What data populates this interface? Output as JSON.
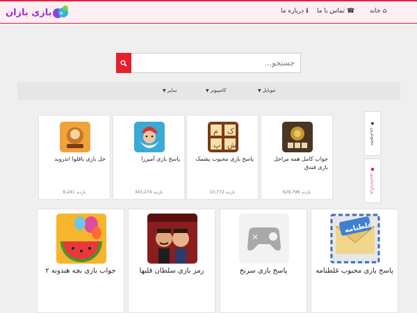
{
  "brand": {
    "name": "بازی بازان"
  },
  "nav": {
    "home": "خانه",
    "contact": "تماس با ما",
    "about": "درباره ما"
  },
  "search": {
    "placeholder": "جستجو..."
  },
  "categories": {
    "mobile": "موبایل",
    "computer": "کامپیوتر",
    "other": "سایر"
  },
  "side_tabs": {
    "popular": "محبوبترین",
    "views": "پربازدیدترین"
  },
  "cards_small": [
    {
      "title": "جواب کامل همه مراحل بازی فندق",
      "views": "629,796 بازدید"
    },
    {
      "title": "پاسخ بازی محبوب پشمک",
      "views": "10,772 بازدید"
    },
    {
      "title": "پاسخ بازی آمیرزا",
      "views": "343,274 بازدید"
    },
    {
      "title": "حل بازی باقلوا اندروید",
      "views": "6,241 بازدید"
    }
  ],
  "cards_big": [
    {
      "title": "پاسخ بازی محبوب غلطنامه"
    },
    {
      "title": "پاسخ بازی سرنخ"
    },
    {
      "title": "رمز بازی سلطان قلبها"
    },
    {
      "title": "جواب بازی بچه هندونه ۲"
    }
  ],
  "colors": {
    "accent": "#e91e3f",
    "brand": "#9b2fd0",
    "search_button": "#e4202f"
  }
}
